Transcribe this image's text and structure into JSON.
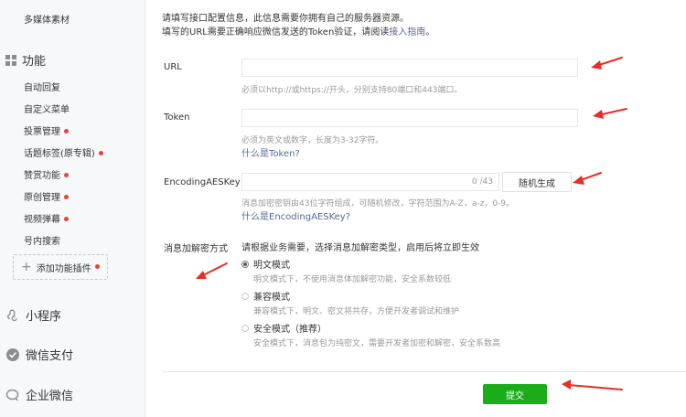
{
  "sidebar": {
    "top_item": "多媒体素材",
    "functions": {
      "heading": "功能",
      "items": [
        {
          "label": "自动回复",
          "dot": false
        },
        {
          "label": "自定义菜单",
          "dot": false
        },
        {
          "label": "投票管理",
          "dot": true
        },
        {
          "label": "话题标签(原专辑)",
          "dot": true
        },
        {
          "label": "赞赏功能",
          "dot": true
        },
        {
          "label": "原创管理",
          "dot": true
        },
        {
          "label": "视频弹幕",
          "dot": true
        },
        {
          "label": "号内搜索",
          "dot": false
        }
      ],
      "add_plugin": "添加功能插件"
    },
    "mini_program": "小程序",
    "wechat_pay": "微信支付",
    "wecom": "企业微信"
  },
  "intro": {
    "line1": "请填写接口配置信息，此信息需要你拥有自己的服务器资源。",
    "line2_prefix": "填写的URL需要正确响应微信发送的Token验证，请阅读",
    "line2_link": "接入指南",
    "line2_suffix": "。"
  },
  "form": {
    "url": {
      "label": "URL",
      "value": "",
      "hint": "必须以http://或https://开头，分别支持80端口和443端口。"
    },
    "token": {
      "label": "Token",
      "value": "",
      "hint": "必须为英文或数字，长度为3-32字符。",
      "link": "什么是Token?"
    },
    "aes": {
      "label": "EncodingAESKey",
      "value": "",
      "counter": "0 /43",
      "random_button": "随机生成",
      "hint": "消息加密密钥由43位字符组成，可随机修改，字符范围为A-Z，a-z，0-9。",
      "link": "什么是EncodingAESKey?"
    },
    "encryption": {
      "label": "消息加解密方式",
      "description": "请根据业务需要，选择消息加解密类型，启用后将立即生效",
      "options": [
        {
          "label": "明文模式",
          "desc": "明文模式下，不使用消息体加解密功能，安全系数较低",
          "checked": true
        },
        {
          "label": "兼容模式",
          "desc": "兼容模式下，明文、密文将共存，方便开发者调试和维护",
          "checked": false
        },
        {
          "label": "安全模式（推荐）",
          "desc": "安全模式下，消息包为纯密文，需要开发者加密和解密，安全系数高",
          "checked": false
        }
      ]
    },
    "submit": "提交"
  },
  "colors": {
    "annotation_arrow": "#e82d27",
    "submit_green": "#1aad19",
    "link_blue": "#576b95",
    "status_dot": "#e64340"
  }
}
